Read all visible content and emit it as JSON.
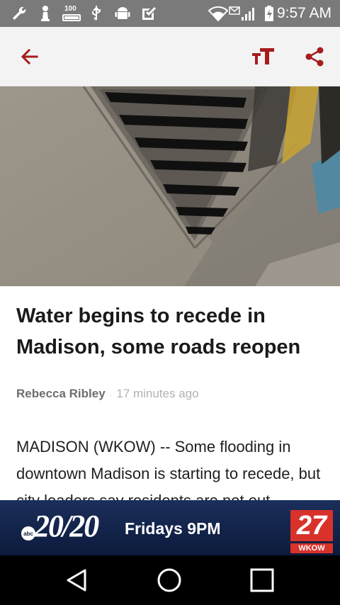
{
  "status_bar": {
    "time": "9:57 AM",
    "battery_level": "100",
    "icons": [
      "wrench-icon",
      "chess-pawn-icon",
      "battery-100-icon",
      "usb-icon",
      "android-icon",
      "check-box-icon",
      "wifi-icon",
      "mail-icon",
      "signal-icon",
      "battery-icon"
    ]
  },
  "app_bar": {
    "back_icon": "arrow-left-icon",
    "text_size_icon": "text-size-icon",
    "share_icon": "share-icon",
    "accent_color": "#a51d1d"
  },
  "article": {
    "headline": "Water begins to recede in Madison, some roads reopen",
    "author": "Rebecca Ribley",
    "separator": "·",
    "time_ago": "17 minutes ago",
    "body": "MADISON (WKOW) -- Some flooding in downtown Madison is starting to recede, but city leaders say residents are not out"
  },
  "ad": {
    "network": "abc",
    "show": "20/20",
    "tagline": "Fridays 9PM",
    "station_number": "27",
    "station_call": "WKOW"
  },
  "nav_bar": {
    "back_icon": "nav-back-icon",
    "home_icon": "nav-home-icon",
    "recents_icon": "nav-recents-icon"
  }
}
